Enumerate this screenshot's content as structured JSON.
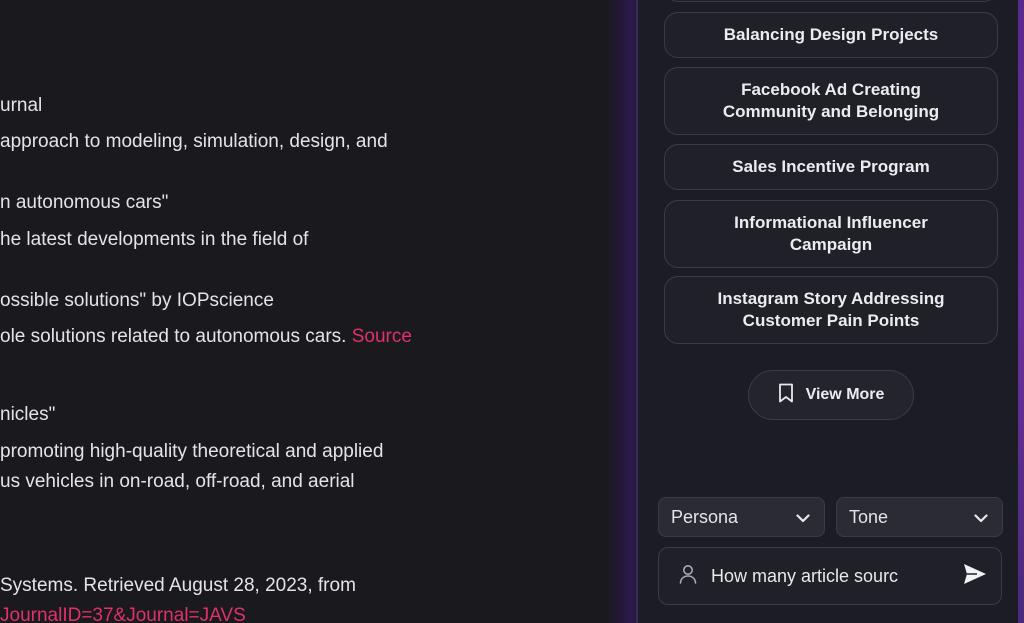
{
  "article": {
    "lines": [
      "urnal",
      "approach to modeling, simulation, design, and",
      "n autonomous cars\"",
      "he latest developments in the field of",
      "ossible solutions\" by IOPscience",
      "ole solutions related to autonomous cars.",
      "nicles\"",
      "promoting high-quality theoretical and applied",
      "us vehicles in on-road, off-road, and aerial",
      " Systems. Retrieved August 28, 2023, from",
      "JournalID=37&Journal=JAVS"
    ],
    "source_link": "Source"
  },
  "panel": {
    "cards": [
      "Balancing Design Projects",
      "Facebook Ad Creating Community and Belonging",
      "Sales Incentive Program",
      "Informational Influencer Campaign",
      "Instagram Story Addressing Customer Pain Points"
    ],
    "view_more": "View More",
    "persona": "Persona",
    "tone": "Tone",
    "input_value": "How many article sourc"
  },
  "colors": {
    "accent_link": "#e0306a",
    "panel_bg": "#1c1d24"
  }
}
